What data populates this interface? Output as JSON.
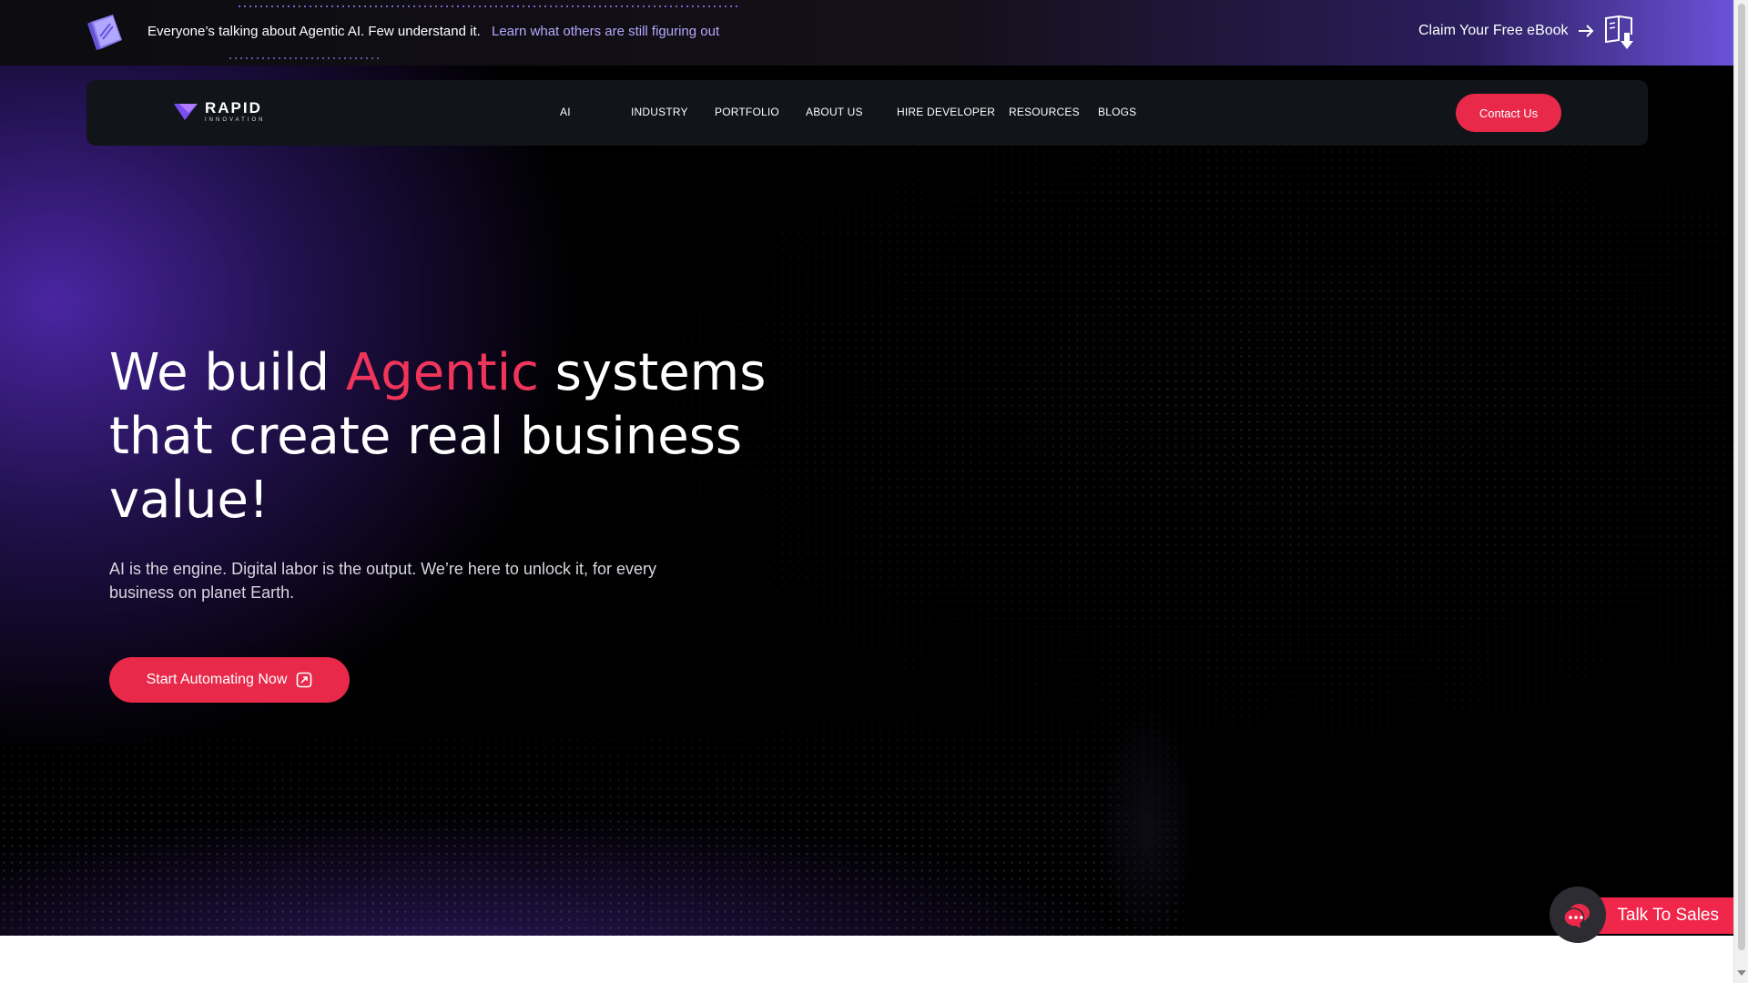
{
  "announcement": {
    "text": "Everyone’s talking about Agentic AI. Few understand it.",
    "link": "Learn what others are still figuring out",
    "claim_label": "Claim Your Free eBook",
    "icon": "book-icon",
    "claim_icon": "ebook-download-icon"
  },
  "nav": {
    "logo_name": "RAPID",
    "logo_sub": "INNOVATION",
    "items": [
      {
        "label": "AI"
      },
      {
        "label": "INDUSTRY"
      },
      {
        "label": "PORTFOLIO"
      },
      {
        "label": "ABOUT US"
      },
      {
        "label": "HIRE DEVELOPER"
      },
      {
        "label": "RESOURCES"
      },
      {
        "label": "BLOGS"
      }
    ],
    "contact_label": "Contact Us"
  },
  "hero": {
    "headline_pre": "We build ",
    "headline_accent": "Agentic",
    "headline_post": " systems that create real business value!",
    "subtext": "AI is the engine. Digital labor is the output. We’re here to unlock it, for every business on planet Earth.",
    "cta_label": "Start Automating Now",
    "cta_icon": "external-link-icon"
  },
  "chat": {
    "label": "Talk To Sales",
    "icon": "chat-icon"
  },
  "colors": {
    "accent": "#e8294a",
    "accent_text": "#f0355a",
    "link": "#b6a8ff",
    "nav_bg": "#111419"
  }
}
